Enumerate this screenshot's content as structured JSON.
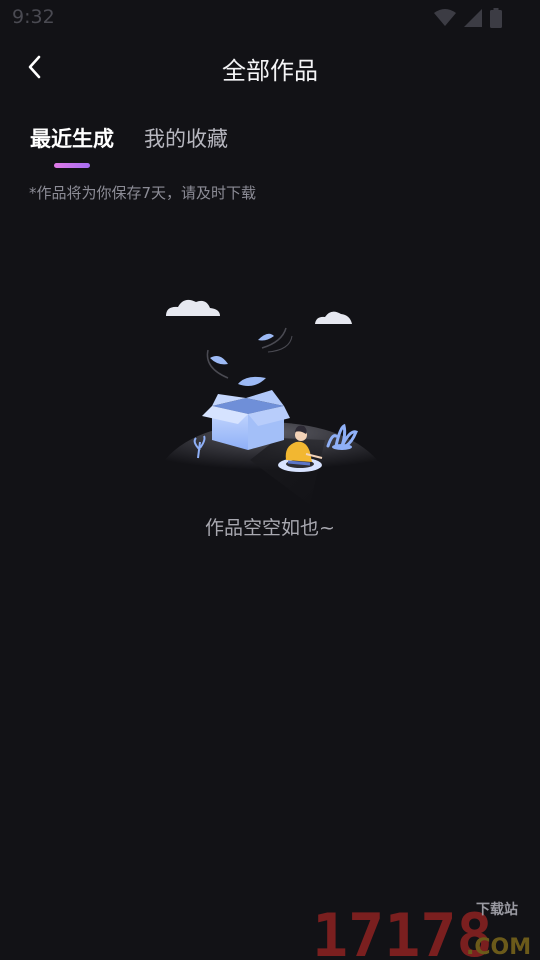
{
  "status_bar": {
    "time": "9:32",
    "icons": [
      "wifi-icon",
      "signal-icon",
      "battery-icon"
    ]
  },
  "header": {
    "title": "全部作品",
    "back_icon": "chevron-left-icon"
  },
  "tabs": [
    {
      "label": "最近生成",
      "active": true
    },
    {
      "label": "我的收藏",
      "active": false
    }
  ],
  "notice": "*作品将为你保存7天，请及时下载",
  "empty_state": {
    "message": "作品空空如也~"
  },
  "watermark": {
    "number": "17178",
    "domain": ".COM",
    "tag": "下载站"
  },
  "colors": {
    "background": "#121216",
    "accent_start": "#e07ae6",
    "accent_end": "#a66ef2",
    "box_blue": "#a9c4ff"
  }
}
